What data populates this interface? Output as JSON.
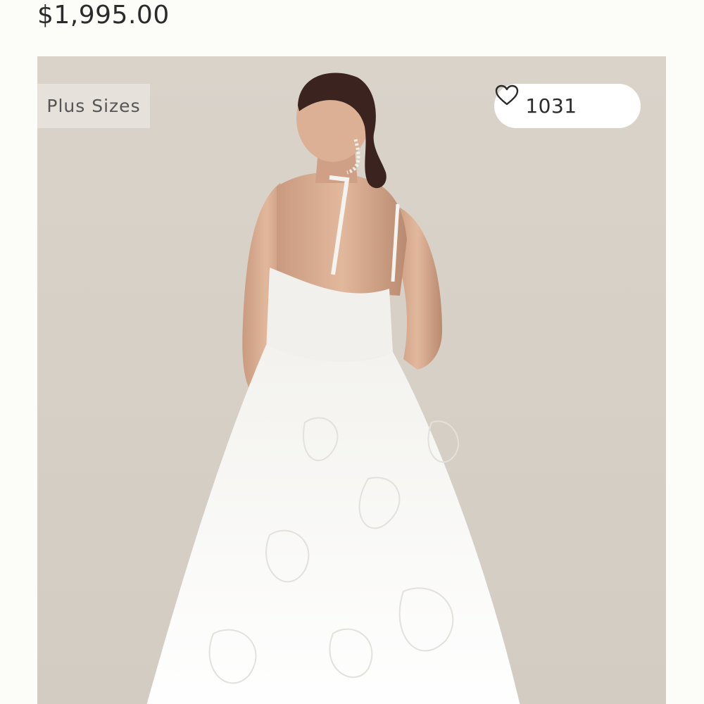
{
  "product": {
    "price": "$1,995.00"
  },
  "image": {
    "badge_label": "Plus Sizes",
    "likes_count": "1031",
    "favorite_icon": "heart-outline-icon"
  },
  "colors": {
    "background": "#fcfcf9",
    "photo_backdrop": "#d6d0c6",
    "badge_background": "#e6e1db",
    "likes_pill_background": "#ffffff",
    "text": "#2b2b2b"
  }
}
